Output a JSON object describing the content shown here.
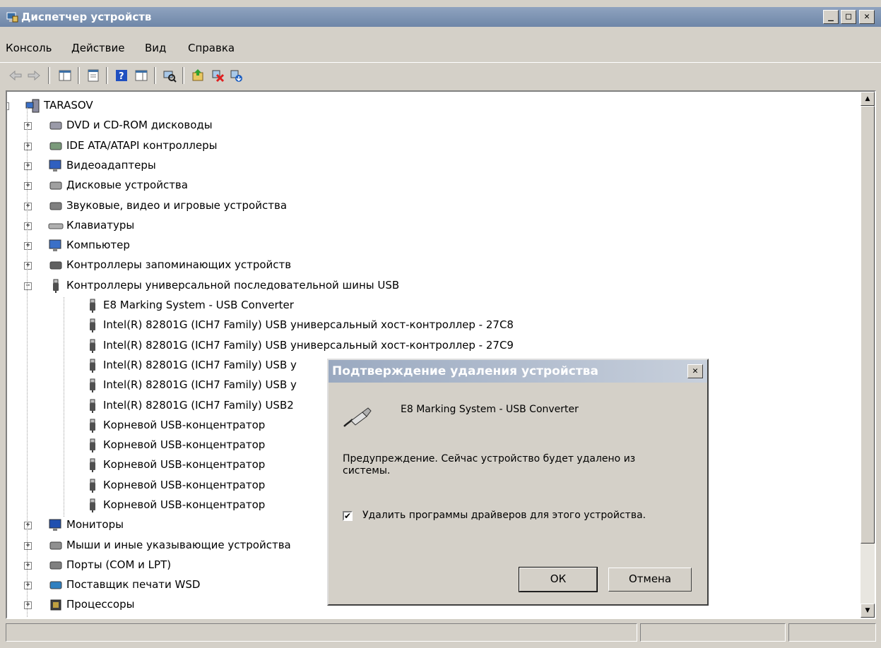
{
  "window": {
    "title": "Диспетчер устройств"
  },
  "menu": [
    "Консоль",
    "Действие",
    "Вид",
    "Справка"
  ],
  "toolbar": {
    "icons": [
      "back-arrow-icon",
      "forward-arrow-icon",
      "show-hide-tree-icon",
      "properties-icon",
      "help-icon",
      "action-pane-icon",
      "scan-hardware-icon",
      "update-driver-icon",
      "uninstall-device-icon",
      "disable-device-icon"
    ]
  },
  "tree": {
    "root": "TARASOV",
    "categories": [
      {
        "label": "DVD и CD-ROM дисководы",
        "icon": "dvd-drive-icon"
      },
      {
        "label": "IDE ATA/ATAPI контроллеры",
        "icon": "ide-controller-icon"
      },
      {
        "label": "Видеоадаптеры",
        "icon": "display-adapter-icon"
      },
      {
        "label": "Дисковые устройства",
        "icon": "disk-drive-icon"
      },
      {
        "label": "Звуковые, видео и игровые устройства",
        "icon": "speaker-icon"
      },
      {
        "label": "Клавиатуры",
        "icon": "keyboard-icon"
      },
      {
        "label": "Компьютер",
        "icon": "computer-icon"
      },
      {
        "label": "Контроллеры запоминающих устройств",
        "icon": "storage-controller-icon"
      },
      {
        "label": "Контроллеры универсальной последовательной шины USB",
        "icon": "usb-icon",
        "expanded": true
      }
    ],
    "usb_devices": [
      "E8 Marking System - USB Converter",
      "Intel(R) 82801G (ICH7 Family) USB универсальный хост-контроллер  - 27C8",
      "Intel(R) 82801G (ICH7 Family) USB универсальный хост-контроллер  - 27C9",
      "Intel(R) 82801G (ICH7 Family) USB у",
      "Intel(R) 82801G (ICH7 Family) USB у",
      "Intel(R) 82801G (ICH7 Family) USB2",
      "Корневой USB-концентратор",
      "Корневой USB-концентратор",
      "Корневой USB-концентратор",
      "Корневой USB-концентратор",
      "Корневой USB-концентратор"
    ],
    "after": [
      {
        "label": "Мониторы",
        "icon": "monitor-icon"
      },
      {
        "label": "Мыши и иные указывающие устройства",
        "icon": "mouse-icon"
      },
      {
        "label": "Порты (COM и LPT)",
        "icon": "port-icon"
      },
      {
        "label": "Поставщик печати WSD",
        "icon": "wsd-printer-icon"
      },
      {
        "label": "Процессоры",
        "icon": "processor-icon"
      }
    ]
  },
  "dialog": {
    "title": "Подтверждение удаления устройства",
    "device_name": "E8 Marking System - USB Converter",
    "warning": "Предупреждение. Сейчас устройство будет удалено из системы.",
    "checkbox_label": "Удалить программы драйверов для этого устройства.",
    "checkbox_checked": true,
    "ok_label": "ОК",
    "cancel_label": "Отмена"
  }
}
